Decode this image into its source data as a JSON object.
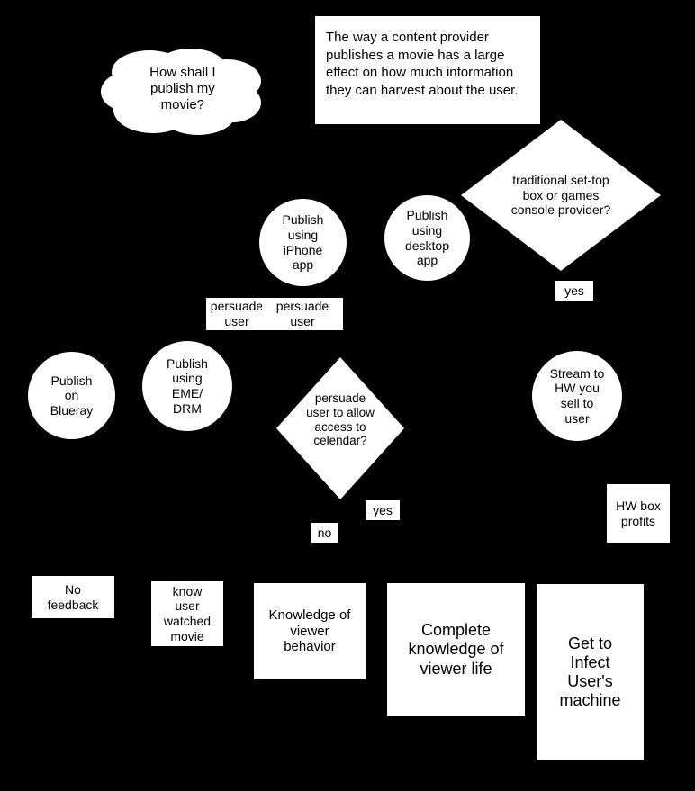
{
  "diagram": {
    "title": "Content publishing / data harvesting flowchart",
    "background_color": "#000000",
    "shape_fill": "#ffffff",
    "text_color": "#000000",
    "nodes": {
      "question_cloud": "How shall I\npublish my\nmovie?",
      "intro_note": "The way a content provider publishes a movie has a large effect on how much information they can harvest about the user.",
      "settop_decision": "traditional set-top\nbox or games\nconsole provider?",
      "publish_iphone": "Publish\nusing\niPhone\napp",
      "publish_desktop": "Publish\nusing\ndesktop\napp",
      "persuade_user_left": "persuade\nuser",
      "persuade_user_right": "persuade\nuser",
      "publish_blueray": "Publish\non\nBlueray",
      "publish_eme_drm": "Publish\nusing\nEME/\nDRM",
      "calendar_decision": "persuade\nuser to allow\naccess to\ncelendar?",
      "stream_hw": "Stream to\nHW you\nsell to\nuser",
      "hw_box_profits": "HW box\nprofits",
      "no_feedback": "No\nfeedback",
      "know_user_watched": "know\nuser\nwatched\nmovie",
      "knowledge_viewer_behavior": "Knowledge of\nviewer\nbehavior",
      "complete_knowledge": "Complete\nknowledge of\nviewer life",
      "get_to_infect": "Get to\nInfect\nUser's\nmachine"
    },
    "edge_labels": {
      "settop_yes": "yes",
      "calendar_yes": "yes",
      "calendar_no": "no"
    }
  }
}
